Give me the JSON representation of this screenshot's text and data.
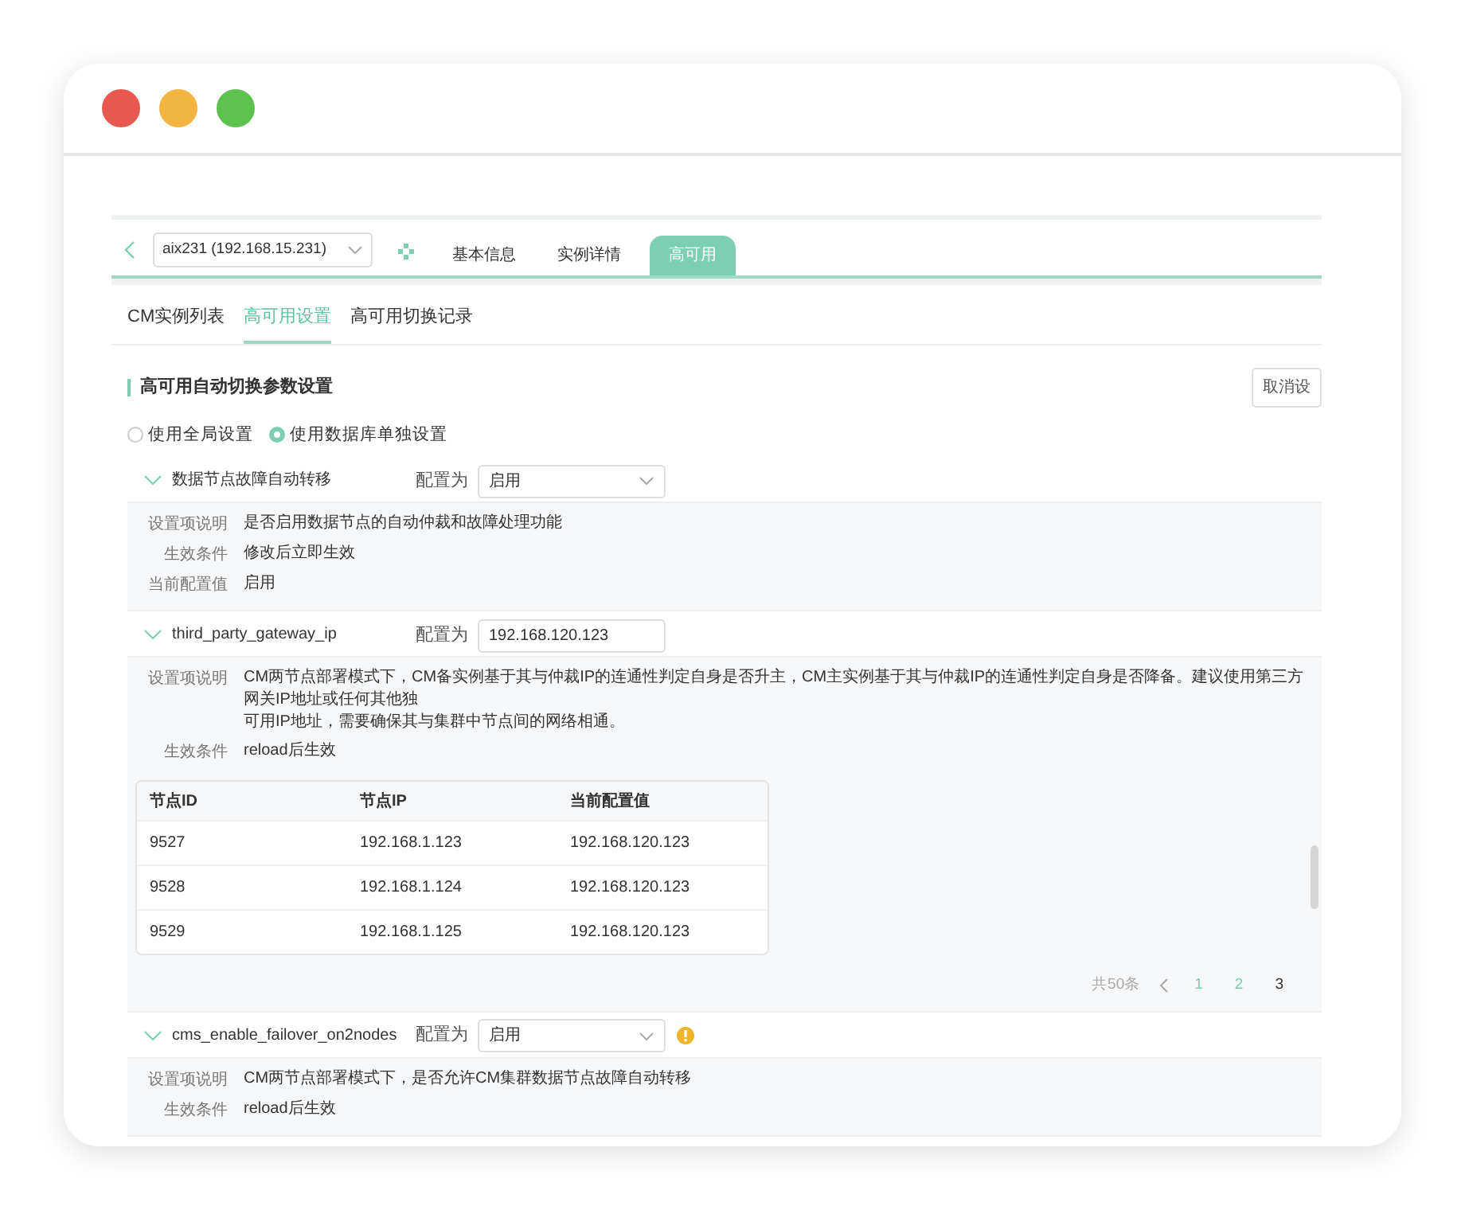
{
  "window": {
    "controls": [
      {
        "color": "#e8584f"
      },
      {
        "color": "#f2b541"
      },
      {
        "color": "#5cc24d"
      }
    ]
  },
  "instance_bar": {
    "instance_select": "aix231 (192.168.15.231)",
    "tabs": [
      {
        "label": "基本信息",
        "selected": false
      },
      {
        "label": "实例详情",
        "selected": false
      },
      {
        "label": "高可用",
        "selected": true
      }
    ]
  },
  "subtabs": [
    {
      "label": "CM实例列表",
      "selected": false
    },
    {
      "label": "高可用设置",
      "selected": true
    },
    {
      "label": "高可用切换记录",
      "selected": false
    }
  ],
  "section": {
    "title": "高可用自动切换参数设置",
    "button": "取消设"
  },
  "scope_options": [
    {
      "label": "使用全局设置",
      "selected": false
    },
    {
      "label": "使用数据库单独设置",
      "selected": true
    }
  ],
  "params": [
    {
      "name": "数据节点故障自动转移",
      "config_label": "配置为",
      "control": {
        "kind": "select",
        "value": "启用"
      },
      "warning": false,
      "details": [
        {
          "label": "设置项说明",
          "lines": [
            "是否启用数据节点的自动仲裁和故障处理功能"
          ]
        },
        {
          "label": "生效条件",
          "lines": [
            "修改后立即生效"
          ]
        },
        {
          "label": "当前配置值",
          "lines": [
            "启用"
          ]
        }
      ]
    },
    {
      "name": "third_party_gateway_ip",
      "config_label": "配置为",
      "control": {
        "kind": "input",
        "value": "192.168.120.123"
      },
      "warning": false,
      "details": [
        {
          "label": "设置项说明",
          "lines": [
            "CM两节点部署模式下，CM备实例基于其与仲裁IP的连通性判定自身是否升主，CM主实例基于其与仲裁IP的连通性判定自身是否降备。建议使用第三方网关IP地址或任何其他独",
            "可用IP地址，需要确保其与集群中节点间的网络相通。"
          ]
        },
        {
          "label": "生效条件",
          "lines": [
            "reload后生效"
          ]
        }
      ],
      "table": {
        "columns": [
          "节点ID",
          "节点IP",
          "当前配置值"
        ],
        "rows": [
          [
            "9527",
            "192.168.1.123",
            "192.168.120.123"
          ],
          [
            "9528",
            "192.168.1.124",
            "192.168.120.123"
          ],
          [
            "9529",
            "192.168.1.125",
            "192.168.120.123"
          ]
        ]
      },
      "pagination": {
        "total": "共50条",
        "pages": [
          {
            "label": "1",
            "selected": false
          },
          {
            "label": "2",
            "selected": false
          },
          {
            "label": "3",
            "selected": true
          }
        ]
      }
    },
    {
      "name": "cms_enable_failover_on2nodes",
      "config_label": "配置为",
      "control": {
        "kind": "select",
        "value": "启用"
      },
      "warning": true,
      "details": [
        {
          "label": "设置项说明",
          "lines": [
            "CM两节点部署模式下，是否允许CM集群数据节点故障自动转移"
          ]
        },
        {
          "label": "生效条件",
          "lines": [
            "reload后生效"
          ]
        }
      ]
    }
  ]
}
